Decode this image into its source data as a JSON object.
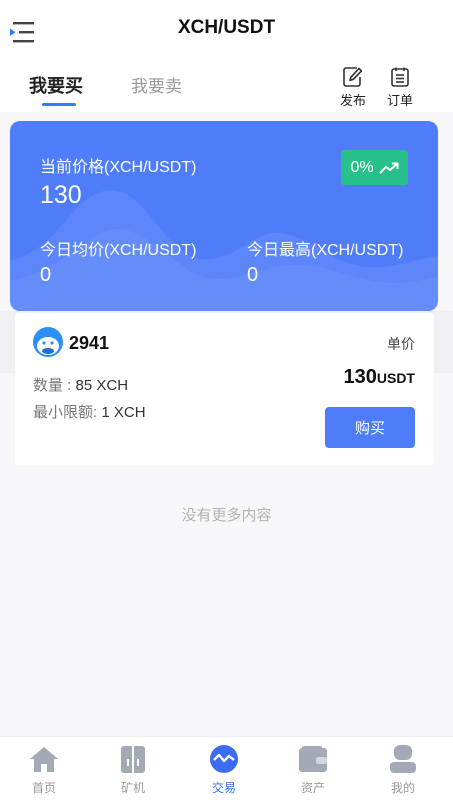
{
  "header": {
    "title": "XCH/USDT"
  },
  "tabs": {
    "buy": "我要买",
    "sell": "我要卖"
  },
  "actions": {
    "publish": "发布",
    "orders": "订单"
  },
  "price_card": {
    "current_label": "当前价格(XCH/USDT)",
    "current_value": "130",
    "change": "0%",
    "avg_label": "今日均价(XCH/USDT)",
    "avg_value": "0",
    "high_label": "今日最高(XCH/USDT)",
    "high_value": "0"
  },
  "order": {
    "seller": "2941",
    "unit_label": "单价",
    "quantity_label": "数量 : ",
    "quantity_value": "85 XCH",
    "min_label": "最小限额: ",
    "min_value": "1 XCH",
    "price": "130",
    "price_unit": "USDT",
    "buy_label": "购买"
  },
  "footer_text": "没有更多内容",
  "tabbar": {
    "home": "首页",
    "miner": "矿机",
    "trade": "交易",
    "assets": "资产",
    "mine": "我的"
  },
  "colors": {
    "accent": "#4f7cf9",
    "positive": "#27c08a",
    "tab_active": "#3b6bf0"
  }
}
